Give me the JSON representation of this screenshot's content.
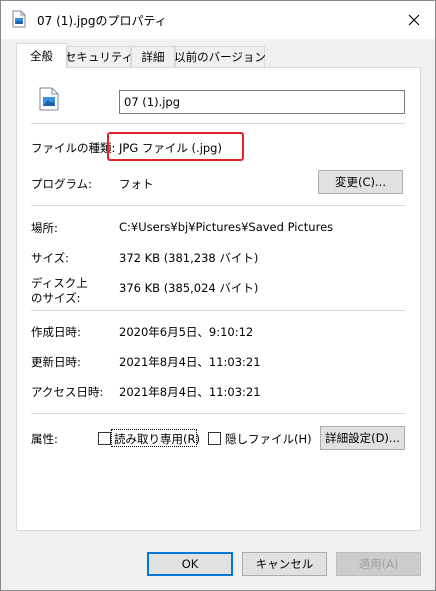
{
  "window": {
    "title": "07 (1).jpgのプロパティ",
    "close_glyph": "✕"
  },
  "tabs": [
    {
      "label": "全般",
      "active": true
    },
    {
      "label": "セキュリティ",
      "active": false
    },
    {
      "label": "詳細",
      "active": false
    },
    {
      "label": "以前のバージョン",
      "active": false
    }
  ],
  "general": {
    "file_name": "07 (1).jpg",
    "file_type_label": "ファイルの種類:",
    "file_type_value": "JPG ファイル (.jpg)",
    "program_label": "プログラム:",
    "program_value": "フォト",
    "change_button": "変更(C)...",
    "location_label": "場所:",
    "location_value": "C:¥Users¥bj¥Pictures¥Saved Pictures",
    "size_label": "サイズ:",
    "size_value": "372 KB (381,238 バイト)",
    "disk_size_label_line1": "ディスク上",
    "disk_size_label_line2": "のサイズ:",
    "disk_size_value": "376 KB (385,024 バイト)",
    "created_label": "作成日時:",
    "created_value": "2020年6月5日、9:10:12",
    "modified_label": "更新日時:",
    "modified_value": "2021年8月4日、11:03:21",
    "accessed_label": "アクセス日時:",
    "accessed_value": "2021年8月4日、11:03:21",
    "attributes_label": "属性:",
    "readonly_label": "読み取り専用(R)",
    "readonly_checked": false,
    "hidden_label": "隠しファイル(H)",
    "hidden_checked": false,
    "advanced_button": "詳細設定(D)..."
  },
  "footer": {
    "ok_button": "OK",
    "cancel_button": "キャンセル",
    "apply_button": "適用(A)"
  },
  "colors": {
    "highlight_border": "#e8202a",
    "primary_button_border": "#0078d7"
  },
  "icons": {
    "title_icon": "image-file-icon",
    "file_icon": "image-file-icon",
    "close": "close-icon"
  }
}
